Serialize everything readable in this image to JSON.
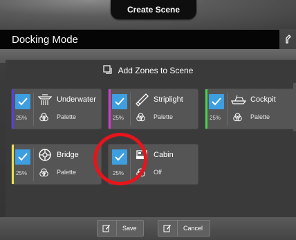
{
  "header": {
    "title": "Create Scene"
  },
  "scene": {
    "name": "Docking Mode"
  },
  "section": {
    "title": "Add Zones to Scene"
  },
  "zones": [
    {
      "name": "Underwater",
      "level": "25%",
      "mode": "Palette",
      "checked": true,
      "icon": "underwater-light-icon",
      "accent": "#5a3fd6"
    },
    {
      "name": "Striplight",
      "level": "25%",
      "mode": "Palette",
      "checked": true,
      "icon": "striplight-icon",
      "accent": "#d23bd4"
    },
    {
      "name": "Cockpit",
      "level": "25%",
      "mode": "Palette",
      "checked": true,
      "icon": "boat-icon",
      "accent": "#4bd14b"
    },
    {
      "name": "Bridge",
      "level": "25%",
      "mode": "Palette",
      "checked": true,
      "icon": "helm-wheel-icon",
      "accent": "#e6e24a"
    },
    {
      "name": "Cabin",
      "level": "25%",
      "mode": "Off",
      "checked": true,
      "icon": "cabin-bed-icon",
      "accent": "#555555"
    }
  ],
  "actions": {
    "save_label": "Save",
    "cancel_label": "Cancel"
  },
  "colors": {
    "check": "#3d9ee0",
    "highlight": "#e8141b"
  }
}
